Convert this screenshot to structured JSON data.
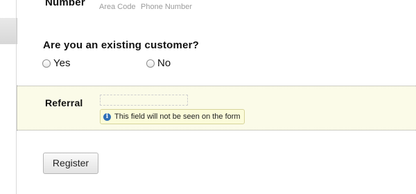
{
  "phone": {
    "label": "Number",
    "area_code_label": "Area Code",
    "phone_number_label": "Phone Number"
  },
  "customer": {
    "question": "Are you an existing customer?",
    "options": [
      "Yes",
      "No"
    ]
  },
  "referral": {
    "label": "Referral",
    "value": "",
    "hint": "This field will not be seen on the form",
    "hint_icon": "info-icon"
  },
  "actions": {
    "register_label": "Register"
  }
}
